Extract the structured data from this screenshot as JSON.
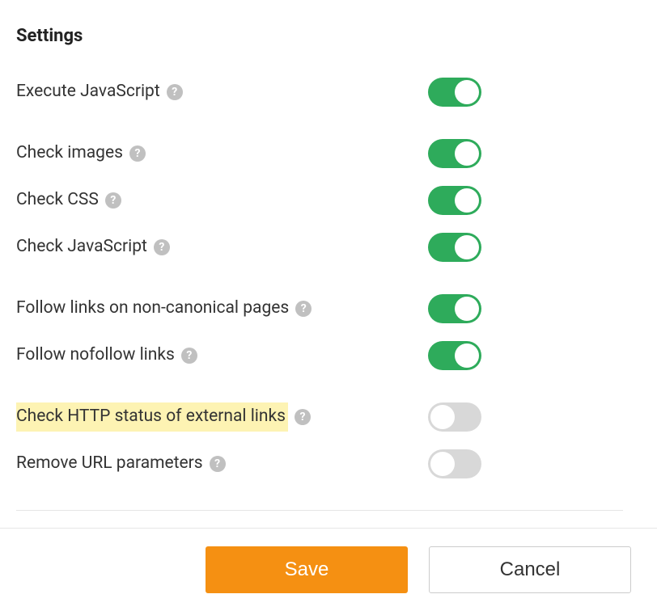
{
  "title": "Settings",
  "rows": [
    {
      "label": "Execute JavaScript",
      "on": true,
      "highlighted": false,
      "gapBelow": true
    },
    {
      "label": "Check images",
      "on": true,
      "highlighted": false,
      "gapBelow": false
    },
    {
      "label": "Check CSS",
      "on": true,
      "highlighted": false,
      "gapBelow": false
    },
    {
      "label": "Check JavaScript",
      "on": true,
      "highlighted": false,
      "gapBelow": true
    },
    {
      "label": "Follow links on non-canonical pages",
      "on": true,
      "highlighted": false,
      "gapBelow": false
    },
    {
      "label": "Follow nofollow links",
      "on": true,
      "highlighted": false,
      "gapBelow": true
    },
    {
      "label": "Check HTTP status of external links",
      "on": false,
      "highlighted": true,
      "gapBelow": false
    },
    {
      "label": "Remove URL parameters",
      "on": false,
      "highlighted": false,
      "gapBelow": false
    }
  ],
  "buttons": {
    "save": "Save",
    "cancel": "Cancel"
  }
}
